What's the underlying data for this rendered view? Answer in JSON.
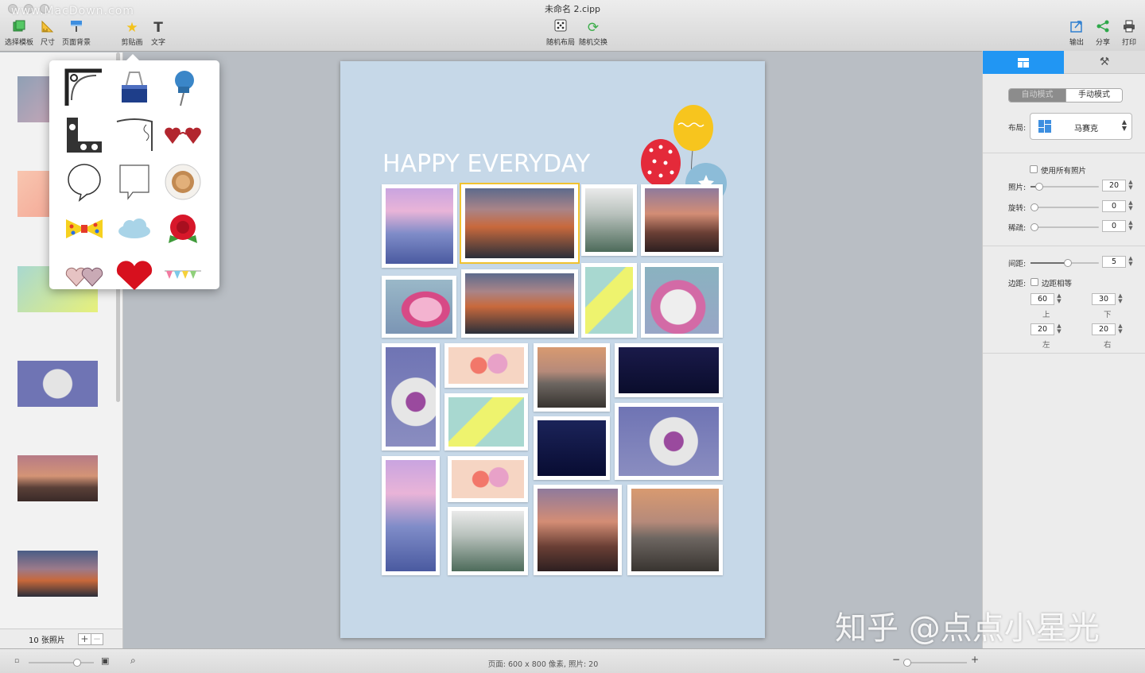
{
  "window": {
    "title": "未命名 2.cipp",
    "watermark": "www.MacDown.com"
  },
  "toolbar": {
    "left": [
      {
        "label": "选择模板",
        "icon": "template-icon"
      },
      {
        "label": "尺寸",
        "icon": "ruler-icon"
      },
      {
        "label": "页面背景",
        "icon": "background-icon"
      },
      {
        "label": "剪贴画",
        "icon": "star-icon"
      },
      {
        "label": "文字",
        "icon": "text-icon"
      }
    ],
    "center": [
      {
        "label": "随机布局",
        "icon": "dice-icon"
      },
      {
        "label": "随机交换",
        "icon": "swap-icon"
      }
    ],
    "right": [
      {
        "label": "输出",
        "icon": "export-icon"
      },
      {
        "label": "分享",
        "icon": "share-icon"
      },
      {
        "label": "打印",
        "icon": "print-icon"
      }
    ]
  },
  "left_panel": {
    "photo_count": "10 张照片",
    "add": "+",
    "remove": "−"
  },
  "clipart": [
    "ornate-corner",
    "binder-clip",
    "push-pin",
    "ornate-frame",
    "scroll-corner",
    "heart-sunglasses",
    "speech-bubble-round",
    "speech-bubble-square",
    "coffee-cup",
    "bow-tie",
    "cloud",
    "red-rose",
    "fabric-hearts",
    "red-heart",
    "bunting-flags"
  ],
  "canvas": {
    "headline": "HAPPY EVERYDAY"
  },
  "right_panel": {
    "mode_auto": "自动模式",
    "mode_manual": "手动模式",
    "layout_label": "布局:",
    "layout_value": "马赛克",
    "use_all": "使用所有照片",
    "photos_label": "照片:",
    "photos_value": "20",
    "rotate_label": "旋转:",
    "rotate_value": "0",
    "sparse_label": "稀疏:",
    "sparse_value": "0",
    "spacing_label": "间距:",
    "spacing_value": "5",
    "margin_label": "边距:",
    "margin_equal": "边距相等",
    "margin_top": "60",
    "margin_bottom": "30",
    "margin_left": "20",
    "margin_right": "20",
    "top_label": "上",
    "bottom_label": "下",
    "left_label": "左",
    "right_label": "右"
  },
  "status": {
    "text": "页面: 600 x 800 像素, 照片: 20"
  },
  "watermark_zh": "知乎 @点点小星光"
}
